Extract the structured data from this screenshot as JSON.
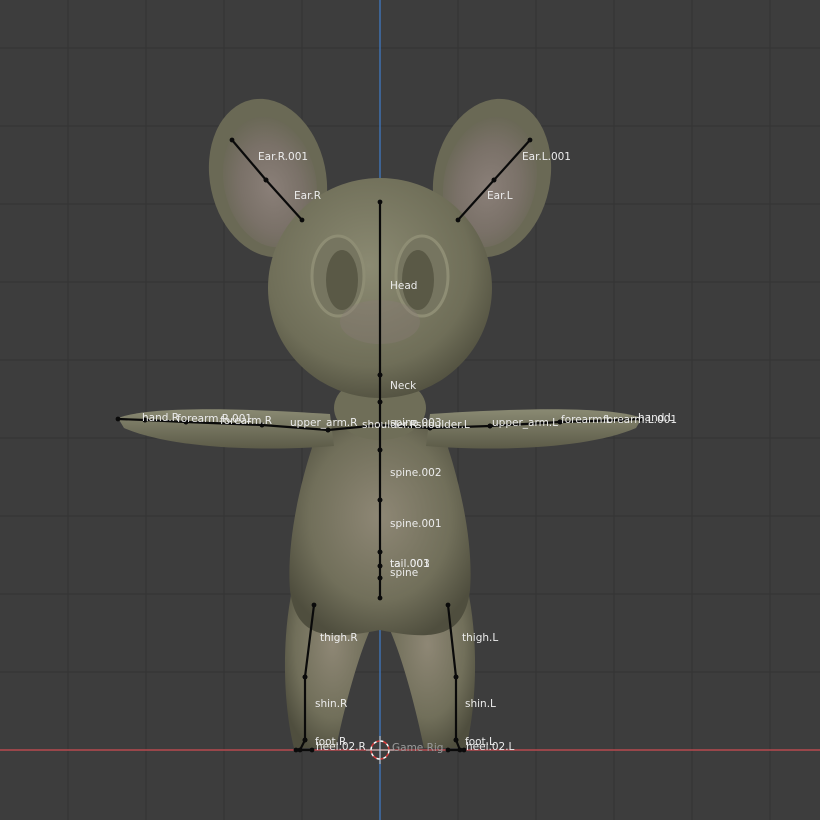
{
  "viewport": {
    "background": "#3d3d3d",
    "grid_color": "#333333",
    "axis_x_color": "#b84a4f",
    "axis_z_color": "#3f74b8",
    "bone_color": "#0a0a0a",
    "label_color": "#ececec",
    "model_color": "#7a7a64"
  },
  "rig": {
    "name": "Game Rig",
    "bones": {
      "ear_r_001": "Ear.R.001",
      "ear_r": "Ear.R",
      "ear_l_001": "Ear.L.001",
      "ear_l": "Ear.L",
      "head": "Head",
      "neck": "Neck",
      "hand_r": "hand.R",
      "forearm_r_001": "forearm.R.001",
      "forearm_r": "forearm.R",
      "upper_arm_r": "upper_arm.R",
      "shoulder_r": "shoulder.R",
      "spine_003": "spine.003",
      "shoulder_l": "shoulder.L",
      "upper_arm_l": "upper_arm.L",
      "forearm_l": "forearm.L",
      "forearm_l_001": "forearm.L.001",
      "hand_l": "hand.L",
      "spine_002": "spine.002",
      "spine_001": "spine.001",
      "tail_001": "tail.001",
      "tail_003": "tail.003",
      "spine": "spine",
      "thigh_r": "thigh.R",
      "thigh_l": "thigh.L",
      "shin_r": "shin.R",
      "shin_l": "shin.L",
      "foot_r": "foot.R",
      "heel_02_r": "heel.02.R",
      "foot_l": "foot.L",
      "heel_02_l": "heel.02.L"
    }
  }
}
